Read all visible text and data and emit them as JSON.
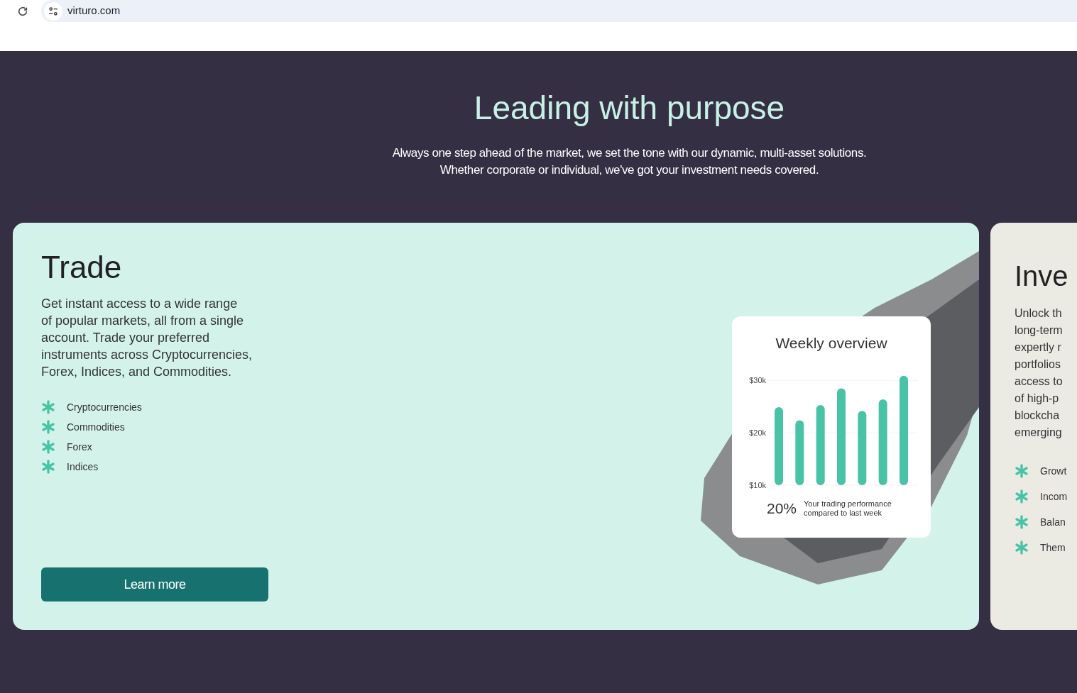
{
  "browser": {
    "url": "virturo.com"
  },
  "hero": {
    "title": "Leading with purpose",
    "subtitle": "Always one step ahead of the market, we set the tone with our dynamic, multi-asset solutions.  Whether corporate or individual, we've got your investment needs covered."
  },
  "cards": [
    {
      "title": "Trade",
      "description": [
        "Get instant access to a wide range",
        "of popular markets, all from a single",
        "account. Trade your preferred",
        "instruments across Cryptocurrencies,",
        "Forex, Indices, and Commodities."
      ],
      "features": [
        "Cryptocurrencies",
        "Commodities",
        "Forex",
        "Indices"
      ],
      "button": "Learn more",
      "chart": {
        "title": "Weekly overview",
        "percent": "20%",
        "caption": [
          "Your trading performance",
          "compared to last week"
        ],
        "chart_data": {
          "type": "bar",
          "ylim": [
            10000,
            31000
          ],
          "yticks": [
            {
              "value": 10000,
              "label": "$10k"
            },
            {
              "value": 20000,
              "label": "$20k"
            },
            {
              "value": 30000,
              "label": "$30k"
            }
          ],
          "series": [
            {
              "color": "#48c3a6",
              "values": [
                24900,
                22400,
                25300,
                28500,
                24200,
                26400,
                30900
              ]
            }
          ]
        }
      }
    },
    {
      "title": "Inve",
      "description": [
        "Unlock th",
        "long-term",
        "expertly r",
        "portfolios",
        "access to",
        "of high-p",
        "blockcha",
        "emerging"
      ],
      "features": [
        "Growt",
        "Incom",
        "Balan",
        "Them"
      ]
    }
  ]
}
